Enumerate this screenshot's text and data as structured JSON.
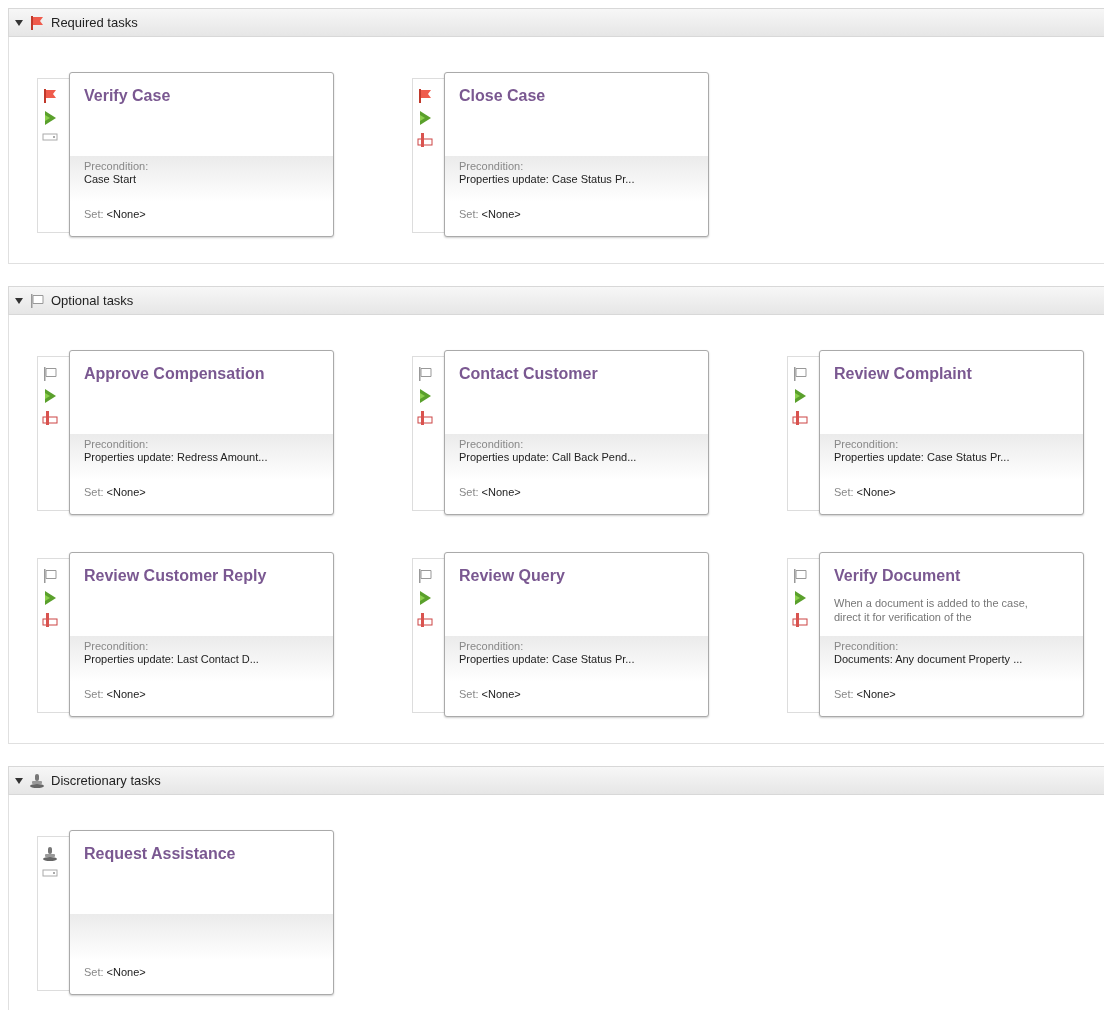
{
  "sections": [
    {
      "kind": "required",
      "title": "Required tasks",
      "expanded": true,
      "tasks": [
        {
          "title": "Verify Case",
          "icons": [
            {
              "kind": "required-flag"
            },
            {
              "kind": "start"
            },
            {
              "kind": "stop-disabled"
            }
          ],
          "precondition": {
            "label": "Precondition:",
            "value": "Case Start"
          },
          "set": {
            "label": "Set:",
            "value": "<None>"
          }
        },
        {
          "title": "Close Case",
          "icons": [
            {
              "kind": "required-flag"
            },
            {
              "kind": "start"
            },
            {
              "kind": "stop-active"
            }
          ],
          "precondition": {
            "label": "Precondition:",
            "value": "Properties update: Case Status Pr..."
          },
          "set": {
            "label": "Set:",
            "value": "<None>"
          }
        }
      ]
    },
    {
      "kind": "optional",
      "title": "Optional tasks",
      "expanded": true,
      "tasks": [
        {
          "title": "Approve Compensation",
          "icons": [
            {
              "kind": "optional-flag"
            },
            {
              "kind": "start"
            },
            {
              "kind": "stop-active"
            }
          ],
          "precondition": {
            "label": "Precondition:",
            "value": "Properties update: Redress Amount..."
          },
          "set": {
            "label": "Set:",
            "value": "<None>"
          }
        },
        {
          "title": "Contact Customer",
          "icons": [
            {
              "kind": "optional-flag"
            },
            {
              "kind": "start"
            },
            {
              "kind": "stop-active"
            }
          ],
          "precondition": {
            "label": "Precondition:",
            "value": "Properties update: Call Back Pend..."
          },
          "set": {
            "label": "Set:",
            "value": "<None>"
          }
        },
        {
          "title": "Review Complaint",
          "icons": [
            {
              "kind": "optional-flag"
            },
            {
              "kind": "start"
            },
            {
              "kind": "stop-active"
            }
          ],
          "precondition": {
            "label": "Precondition:",
            "value": "Properties update: Case Status Pr..."
          },
          "set": {
            "label": "Set:",
            "value": "<None>"
          }
        },
        {
          "title": "Review Customer Reply",
          "icons": [
            {
              "kind": "optional-flag"
            },
            {
              "kind": "start"
            },
            {
              "kind": "stop-active"
            }
          ],
          "precondition": {
            "label": "Precondition:",
            "value": "Properties update: Last Contact D..."
          },
          "set": {
            "label": "Set:",
            "value": "<None>"
          }
        },
        {
          "title": "Review Query",
          "icons": [
            {
              "kind": "optional-flag"
            },
            {
              "kind": "start"
            },
            {
              "kind": "stop-active"
            }
          ],
          "precondition": {
            "label": "Precondition:",
            "value": "Properties update: Case Status Pr..."
          },
          "set": {
            "label": "Set:",
            "value": "<None>"
          }
        },
        {
          "title": "Verify Document",
          "description": "When a document is added to the case, direct it for verification of the",
          "icons": [
            {
              "kind": "optional-flag"
            },
            {
              "kind": "start"
            },
            {
              "kind": "stop-active"
            }
          ],
          "precondition": {
            "label": "Precondition:",
            "value": "Documents: Any document Property ..."
          },
          "set": {
            "label": "Set:",
            "value": "<None>"
          }
        }
      ]
    },
    {
      "kind": "discretionary",
      "title": "Discretionary tasks",
      "expanded": true,
      "tasks": [
        {
          "title": "Request Assistance",
          "icons": [
            {
              "kind": "discretionary-stamp"
            },
            {
              "kind": "stop-disabled"
            }
          ],
          "set": {
            "label": "Set:",
            "value": "<None>"
          }
        }
      ]
    }
  ]
}
